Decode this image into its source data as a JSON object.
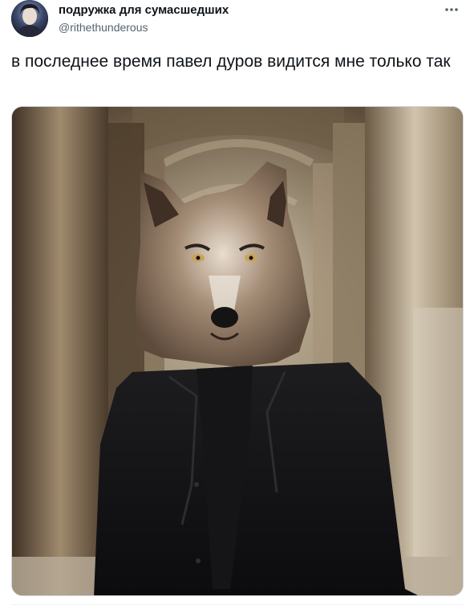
{
  "author": {
    "display_name": "подружка для сумасшедших",
    "handle": "@rithethunderous"
  },
  "icons": {
    "avatar": "avatar-image",
    "more": "more-dots-icon"
  },
  "tweet": {
    "text": "в последнее время павел дуров видится мне только так"
  },
  "media": {
    "kind": "photo",
    "subject": "wolf-headed-figure-in-black-suit"
  },
  "colors": {
    "text": "#0f1419",
    "secondary": "#536471",
    "border": "#cfd9de"
  }
}
